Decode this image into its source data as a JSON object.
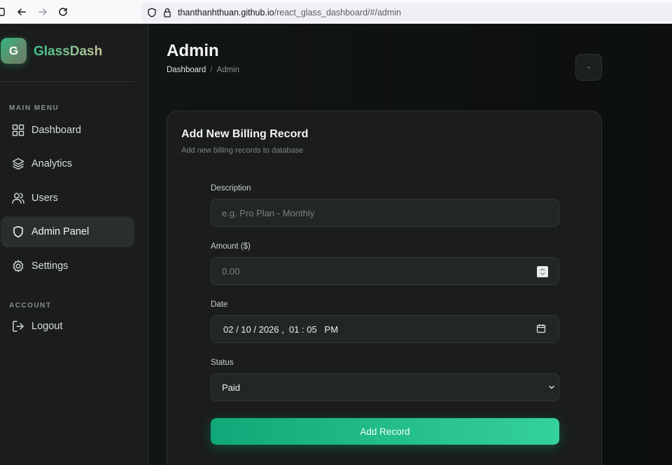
{
  "browser": {
    "url_host": "thanthanhthuan.github.io",
    "url_path": "/react_glass_dashboard/#/admin"
  },
  "sidebar": {
    "logo_letter": "G",
    "brand": "GlassDash",
    "main_menu_label": "MAIN MENU",
    "account_label": "ACCOUNT",
    "items": [
      {
        "label": "Dashboard",
        "icon": "grid-icon"
      },
      {
        "label": "Analytics",
        "icon": "layers-icon"
      },
      {
        "label": "Users",
        "icon": "users-icon"
      },
      {
        "label": "Admin Panel",
        "icon": "shield-icon",
        "active": true
      },
      {
        "label": "Settings",
        "icon": "gear-icon"
      }
    ],
    "logout_label": "Logout"
  },
  "header": {
    "title": "Admin",
    "breadcrumb": [
      "Dashboard",
      "Admin"
    ],
    "separator": "/",
    "top_button_label": "+"
  },
  "form": {
    "title": "Add New Billing Record",
    "subtitle": "Add new billing records to database",
    "description": {
      "label": "Description",
      "placeholder": "e.g. Pro Plan - Monthly"
    },
    "amount": {
      "label": "Amount ($)",
      "placeholder": "0.00"
    },
    "date": {
      "label": "Date",
      "value": "02 / 10 / 2026 ,  01 : 05   PM"
    },
    "status": {
      "label": "Status",
      "value": "Paid"
    },
    "submit_label": "Add Record"
  },
  "colors": {
    "accent": "#10a878",
    "accent_light": "#35d19a",
    "background": "#0c0f0e",
    "sidebar": "#1a1d1c"
  }
}
